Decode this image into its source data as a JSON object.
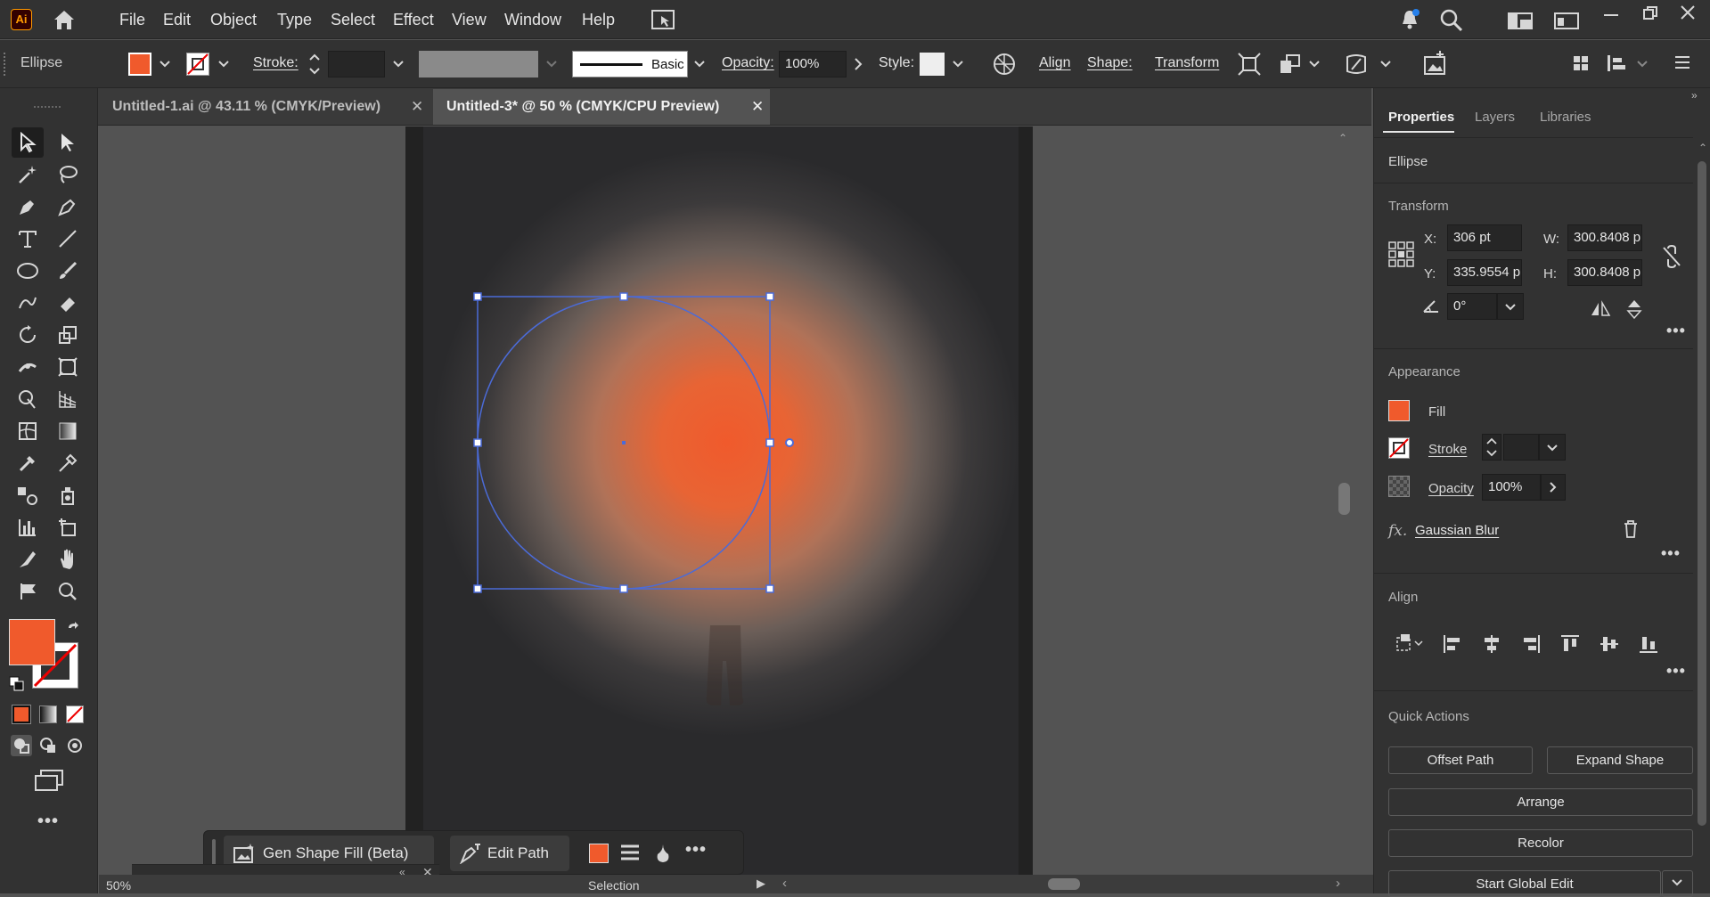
{
  "app": {
    "logo": "Ai"
  },
  "menu": [
    "File",
    "Edit",
    "Object",
    "Type",
    "Select",
    "Effect",
    "View",
    "Window",
    "Help"
  ],
  "control": {
    "object_type": "Ellipse",
    "fill_color": "#f05a2c",
    "stroke_label": "Stroke:",
    "brush_label": "Basic",
    "opacity_label": "Opacity:",
    "opacity_value": "100%",
    "style_label": "Style:",
    "align_label": "Align",
    "shape_label": "Shape:",
    "transform_label": "Transform"
  },
  "tabs": [
    {
      "title": "Untitled-1.ai @ 43.11 % (CMYK/Preview)",
      "active": false
    },
    {
      "title": "Untitled-3* @ 50 % (CMYK/CPU Preview)",
      "active": true
    }
  ],
  "panel": {
    "tabs": [
      "Properties",
      "Layers",
      "Libraries"
    ],
    "object_type": "Ellipse",
    "transform": {
      "title": "Transform",
      "x_label": "X:",
      "x": "306 pt",
      "y_label": "Y:",
      "y": "335.9554 p",
      "w_label": "W:",
      "w": "300.8408 p",
      "h_label": "H:",
      "h": "300.8408 p",
      "angle": "0°"
    },
    "appearance": {
      "title": "Appearance",
      "fill_label": "Fill",
      "stroke_label": "Stroke",
      "opacity_label": "Opacity",
      "opacity_value": "100%",
      "effect": "Gaussian Blur"
    },
    "align": {
      "title": "Align"
    },
    "quick_actions": {
      "title": "Quick Actions",
      "offset_path": "Offset Path",
      "expand_shape": "Expand Shape",
      "arrange": "Arrange",
      "recolor": "Recolor",
      "start_global_edit": "Start Global Edit"
    }
  },
  "context_bar": {
    "gen_shape_fill": "Gen Shape Fill (Beta)",
    "edit_path": "Edit Path"
  },
  "status": {
    "zoom": "50%",
    "tool": "Selection"
  },
  "colors": {
    "accent_fill": "#f05a2c",
    "selection": "#4b6bd8"
  }
}
